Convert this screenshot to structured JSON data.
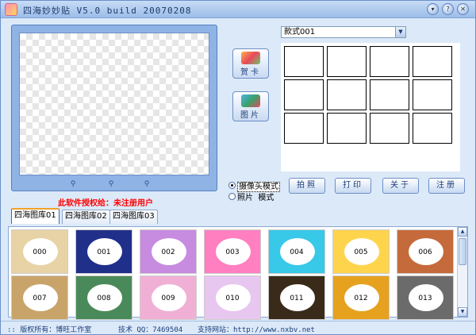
{
  "window": {
    "title": "四海妙妙贴 V5.0 build 20070208",
    "controls": [
      "minimize-icon",
      "help-icon",
      "close-icon"
    ]
  },
  "side_buttons": [
    {
      "name": "card",
      "label": "贺卡"
    },
    {
      "name": "photo",
      "label": "图片"
    }
  ],
  "style_select": {
    "value": "款式001"
  },
  "modes": [
    {
      "label": "摄像头模式",
      "checked": true
    },
    {
      "label": "照片  模式",
      "checked": false
    }
  ],
  "actions": [
    {
      "name": "capture",
      "label": "拍照"
    },
    {
      "name": "print",
      "label": "打印"
    },
    {
      "name": "about",
      "label": "关于"
    },
    {
      "name": "register",
      "label": "注册"
    }
  ],
  "license_text": "此软件授权给：未注册用户",
  "tabs": [
    {
      "label": "四海图库01",
      "active": true
    },
    {
      "label": "四海图库02",
      "active": false
    },
    {
      "label": "四海图库03",
      "active": false
    }
  ],
  "gallery": [
    {
      "num": "000",
      "color": "#e8d3a6"
    },
    {
      "num": "001",
      "color": "#1f2f8a"
    },
    {
      "num": "002",
      "color": "#c78be0"
    },
    {
      "num": "003",
      "color": "#ff7fc0"
    },
    {
      "num": "004",
      "color": "#38c8e8"
    },
    {
      "num": "005",
      "color": "#ffd44d"
    },
    {
      "num": "006",
      "color": "#c56a3a"
    },
    {
      "num": "007",
      "color": "#c9a46a"
    },
    {
      "num": "008",
      "color": "#4a8a5a"
    },
    {
      "num": "009",
      "color": "#f0b0d6"
    },
    {
      "num": "010",
      "color": "#e7c6f0"
    },
    {
      "num": "011",
      "color": "#3a2a1a"
    },
    {
      "num": "012",
      "color": "#e6a11e"
    },
    {
      "num": "013",
      "color": "#6b6b6b"
    }
  ],
  "statusbar": {
    "copyright": ":: 版权所有：博旺工作室",
    "qq": "技术 QQ：7469504",
    "site": "支持网站：http://www.nxbv.net"
  }
}
